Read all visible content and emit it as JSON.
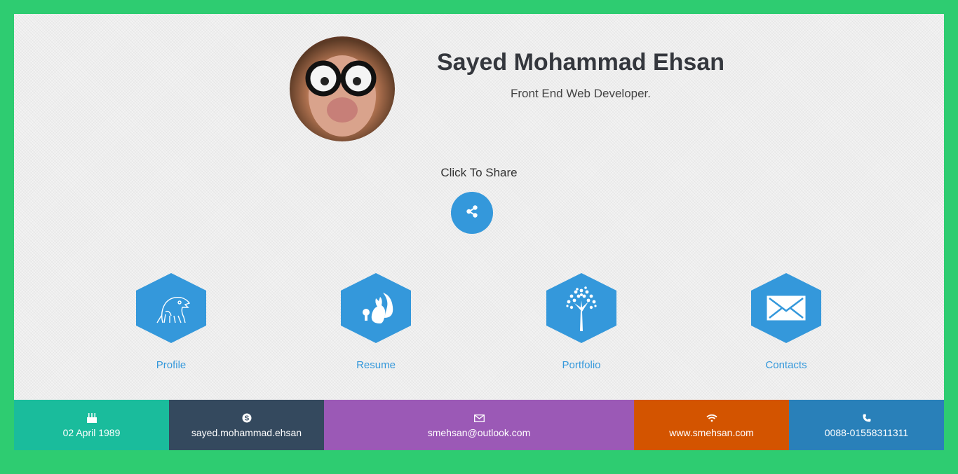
{
  "profile": {
    "name": "Sayed Mohammad Ehsan",
    "title": "Front End Web Developer."
  },
  "share": {
    "label": "Click To Share",
    "icon": "share-icon"
  },
  "nav": [
    {
      "label": "Profile",
      "icon": "eagle-icon"
    },
    {
      "label": "Resume",
      "icon": "squirrel-icon"
    },
    {
      "label": "Portfolio",
      "icon": "tree-icon"
    },
    {
      "label": "Contacts",
      "icon": "envelope-icon"
    }
  ],
  "footer": [
    {
      "text": "02 April 1989",
      "icon": "birthday-cake-icon",
      "color": "#1abc9c"
    },
    {
      "text": "sayed.mohammad.ehsan",
      "icon": "skype-icon",
      "color": "#34495e"
    },
    {
      "text": "smehsan@outlook.com",
      "icon": "mail-icon",
      "color": "#9b59b6"
    },
    {
      "text": "www.smehsan.com",
      "icon": "wifi-icon",
      "color": "#d35400"
    },
    {
      "text": "0088-01558311311",
      "icon": "phone-icon",
      "color": "#2980b9"
    }
  ],
  "colors": {
    "page_border": "#2ecc71",
    "accent": "#3498db"
  }
}
